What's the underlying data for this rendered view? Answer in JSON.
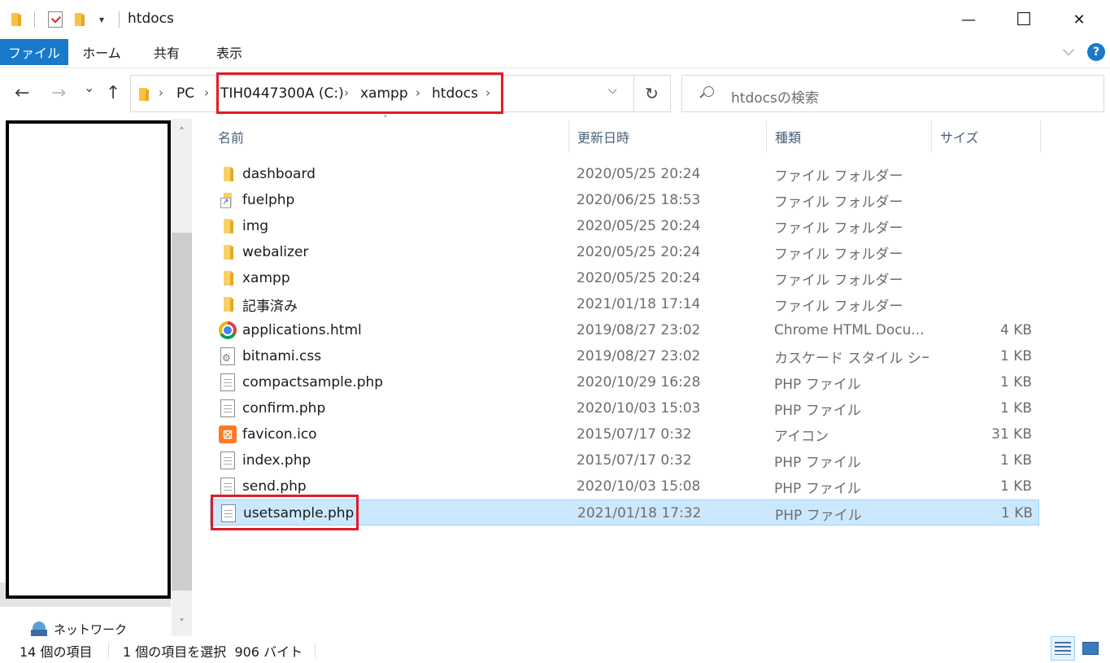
{
  "window": {
    "title": "htdocs",
    "minimize_glyph": "—",
    "maximize_glyph": "☐",
    "close_glyph": "✕",
    "qa_dropdown_glyph": "▾"
  },
  "ribbon": {
    "tabs": [
      "ファイル",
      "ホーム",
      "共有",
      "表示"
    ],
    "help_glyph": "?"
  },
  "nav": {
    "back_glyph": "←",
    "forward_glyph": "→",
    "recent_glyph": "⌄",
    "up_glyph": "↑",
    "crumbs": [
      "PC",
      "TIH0447300A (C:)",
      "xampp",
      "htdocs"
    ],
    "crumb_sep_glyph": "›",
    "dropdown_glyph": "⌵",
    "refresh_glyph": "↻",
    "search_placeholder": "htdocsの検索"
  },
  "left_pane": {
    "network_label": "ネットワーク",
    "scroll_up_glyph": "˄",
    "scroll_down_glyph": "˅"
  },
  "list": {
    "columns": [
      "名前",
      "更新日時",
      "種類",
      "サイズ"
    ],
    "sort_glyph": "˄",
    "rows": [
      {
        "icon": "folder",
        "name": "dashboard",
        "date": "2020/05/25 20:24",
        "type": "ファイル フォルダー",
        "size": ""
      },
      {
        "icon": "folder-link",
        "name": "fuelphp",
        "date": "2020/06/25 18:53",
        "type": "ファイル フォルダー",
        "size": ""
      },
      {
        "icon": "folder",
        "name": "img",
        "date": "2020/05/25 20:24",
        "type": "ファイル フォルダー",
        "size": ""
      },
      {
        "icon": "folder",
        "name": "webalizer",
        "date": "2020/05/25 20:24",
        "type": "ファイル フォルダー",
        "size": ""
      },
      {
        "icon": "folder",
        "name": "xampp",
        "date": "2020/05/25 20:24",
        "type": "ファイル フォルダー",
        "size": ""
      },
      {
        "icon": "folder",
        "name": "記事済み",
        "date": "2021/01/18 17:14",
        "type": "ファイル フォルダー",
        "size": ""
      },
      {
        "icon": "chrome",
        "name": "applications.html",
        "date": "2019/08/27 23:02",
        "type": "Chrome HTML Docu...",
        "size": "4 KB"
      },
      {
        "icon": "css",
        "name": "bitnami.css",
        "date": "2019/08/27 23:02",
        "type": "カスケード スタイル シート...",
        "size": "1 KB"
      },
      {
        "icon": "doc",
        "name": "compactsample.php",
        "date": "2020/10/29 16:28",
        "type": "PHP ファイル",
        "size": "1 KB"
      },
      {
        "icon": "doc",
        "name": "confirm.php",
        "date": "2020/10/03 15:03",
        "type": "PHP ファイル",
        "size": "1 KB"
      },
      {
        "icon": "xampp",
        "name": "favicon.ico",
        "date": "2015/07/17 0:32",
        "type": "アイコン",
        "size": "31 KB"
      },
      {
        "icon": "doc",
        "name": "index.php",
        "date": "2015/07/17 0:32",
        "type": "PHP ファイル",
        "size": "1 KB"
      },
      {
        "icon": "doc",
        "name": "send.php",
        "date": "2020/10/03 15:08",
        "type": "PHP ファイル",
        "size": "1 KB"
      },
      {
        "icon": "doc",
        "name": "usetsample.php",
        "date": "2021/01/18 17:32",
        "type": "PHP ファイル",
        "size": "1 KB",
        "selected": true
      }
    ]
  },
  "status": {
    "item_count": "14 個の項目",
    "selection": "1 個の項目を選択  906 バイト"
  },
  "colors": {
    "accent": "#1979ca",
    "selection": "#cce8ff",
    "highlight_red": "#e21b23"
  }
}
